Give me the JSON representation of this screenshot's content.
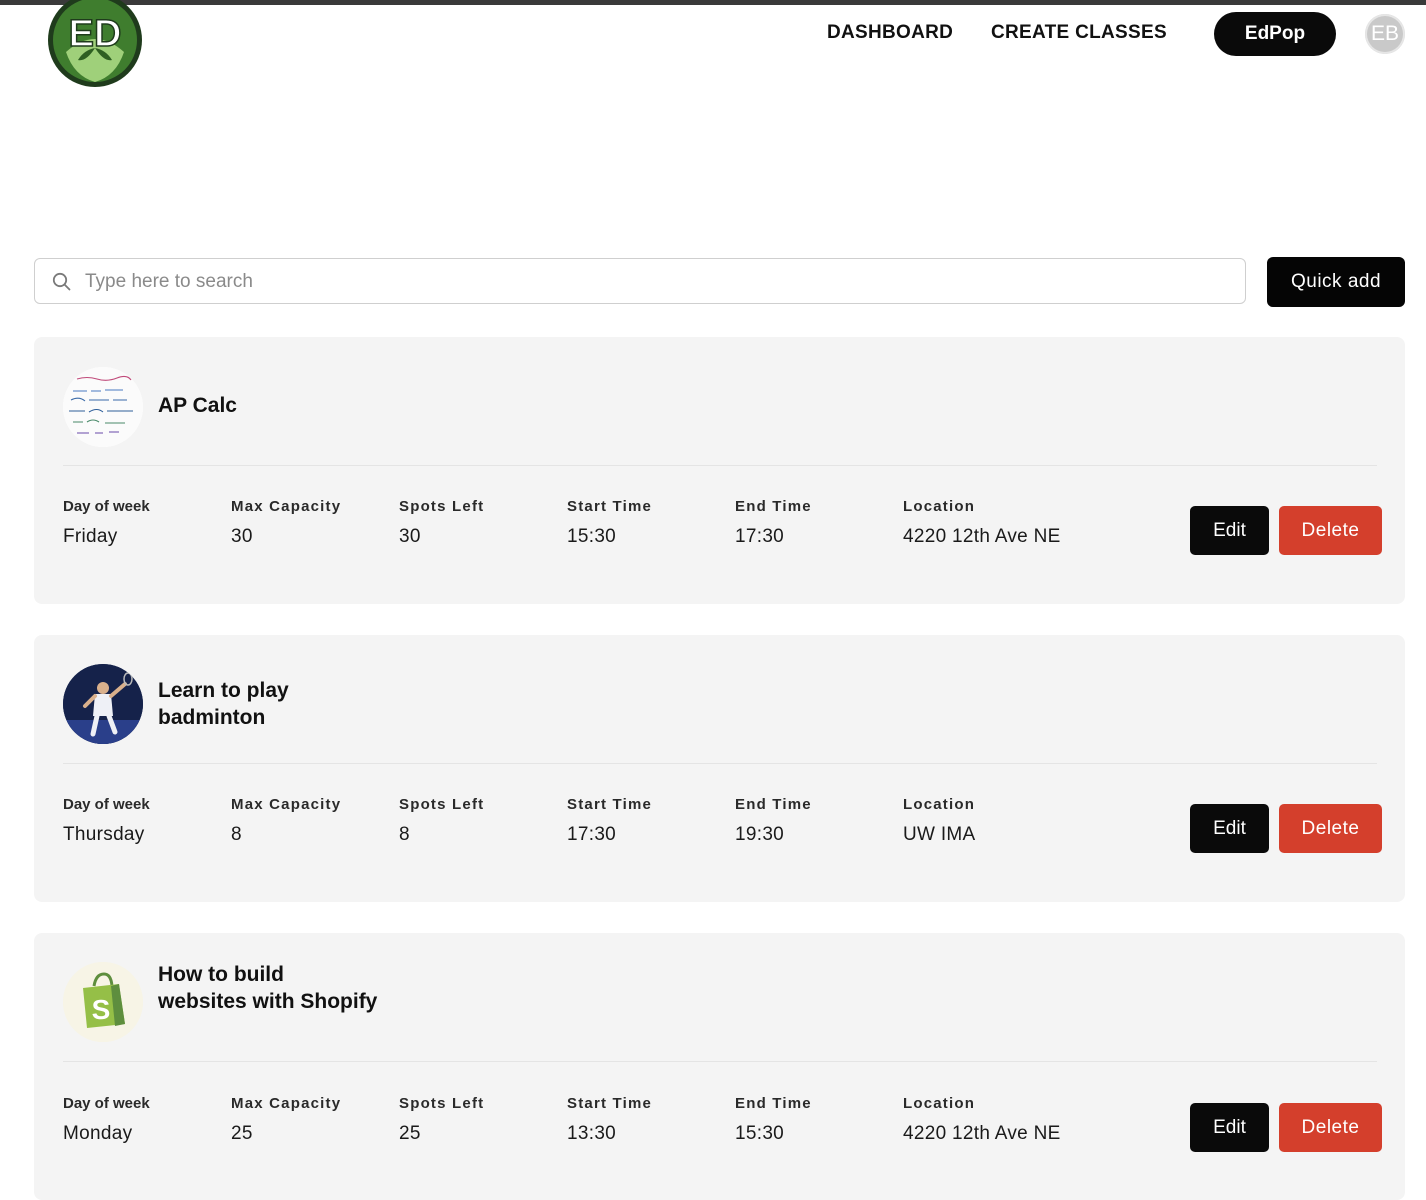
{
  "header": {
    "logo_text": "ED",
    "nav": {
      "dashboard": "DASHBOARD",
      "create_classes": "CREATE CLASSES"
    },
    "brand_button": "EdPop",
    "avatar_initials": "EB"
  },
  "search": {
    "placeholder": "Type here to search",
    "value": ""
  },
  "quick_add_label": "Quick add",
  "labels": {
    "day": "Day of week",
    "capacity": "Max Capacity",
    "spots": "Spots Left",
    "start": "Start Time",
    "end": "End Time",
    "location": "Location",
    "edit": "Edit",
    "delete": "Delete"
  },
  "classes": [
    {
      "title": "AP Calc",
      "thumb": "calc-notes-image",
      "day": "Friday",
      "capacity": "30",
      "spots": "30",
      "start": "15:30",
      "end": "17:30",
      "location": "4220 12th Ave NE"
    },
    {
      "title": "Learn to play badminton",
      "thumb": "badminton-player-image",
      "day": "Thursday",
      "capacity": "8",
      "spots": "8",
      "start": "17:30",
      "end": "19:30",
      "location": "UW IMA"
    },
    {
      "title": "How to build websites with Shopify",
      "thumb": "shopify-bag-icon",
      "day": "Monday",
      "capacity": "25",
      "spots": "25",
      "start": "13:30",
      "end": "15:30",
      "location": "4220 12th Ave NE"
    }
  ],
  "colors": {
    "accent_dark": "#0a0a0a",
    "delete_red": "#d43f2c",
    "card_bg": "#f4f4f4",
    "logo_green": "#3f7d2e"
  }
}
